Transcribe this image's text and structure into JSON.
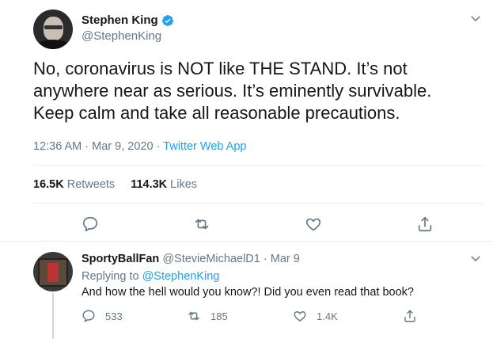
{
  "tweet": {
    "display_name": "Stephen King",
    "handle": "@StephenKing",
    "text": "No, coronavirus is NOT like THE STAND. It’s not anywhere near as serious. It’s eminently survivable. Keep calm and take all reasonable precautions.",
    "time": "12:36 AM",
    "date_sep": " · ",
    "date": "Mar 9, 2020",
    "source_sep": " · ",
    "source": "Twitter Web App",
    "retweets_count": "16.5K",
    "retweets_label": " Retweets",
    "likes_count": "114.3K",
    "likes_label": " Likes"
  },
  "reply": {
    "display_name": "SportyBallFan",
    "handle": " @StevieMichaelD1",
    "dot": " · ",
    "date": "Mar 9",
    "replying_to_label": "Replying to ",
    "replying_to_handle": "@StephenKing",
    "text": "And how the hell would you know?! Did you even read that book?",
    "reply_count": "533",
    "retweet_count": "185",
    "like_count": "1.4K"
  },
  "icons": {
    "verified": "verified-badge-icon",
    "caret": "chevron-down-icon",
    "reply": "reply-icon",
    "retweet": "retweet-icon",
    "like": "heart-icon",
    "share": "share-icon"
  },
  "colors": {
    "accent": "#1da1f2",
    "text": "#14171a",
    "muted": "#657786",
    "border": "#e6ecf0"
  }
}
